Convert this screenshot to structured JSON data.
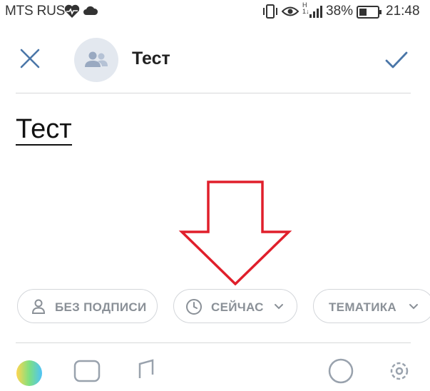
{
  "status_bar": {
    "carrier": "MTS RUS",
    "network": "H",
    "network_sub": "1↓",
    "battery": "38%",
    "time": "21:48"
  },
  "header": {
    "community_name": "Тест",
    "icons": [
      "close-icon",
      "community-avatar-icon",
      "checkmark-icon"
    ]
  },
  "post": {
    "text": "Тест"
  },
  "chips": {
    "signature_label": "БЕЗ ПОДПИСИ",
    "time_label": "СЕЙЧАС",
    "topic_label": "ТЕМАТИКА"
  },
  "toolbar": {
    "icons": [
      "color-background-icon",
      "photo-icon",
      "music-icon",
      "poll-icon",
      "settings-icon"
    ]
  },
  "colors": {
    "accent": "#4a76a8",
    "annotation_arrow": "#e01f2b",
    "chip_text": "#8a9097",
    "divider": "#d7d8d9"
  }
}
